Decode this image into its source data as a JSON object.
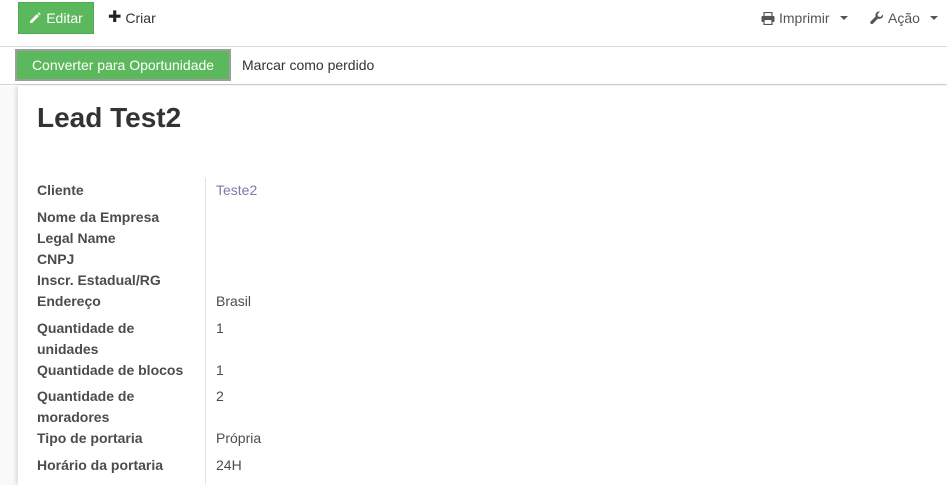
{
  "toolbar": {
    "edit_label": "Editar",
    "create_label": "Criar",
    "print_label": "Imprimir",
    "action_label": "Ação"
  },
  "statusbar": {
    "convert_label": "Converter para Oportunidade",
    "lost_label": "Marcar como perdido"
  },
  "record": {
    "title": "Lead Test2",
    "fields": [
      {
        "label": "Cliente",
        "value": "Teste2"
      },
      {
        "label": "Nome da Empresa",
        "value": ""
      },
      {
        "label": "Legal Name",
        "value": ""
      },
      {
        "label": "CNPJ",
        "value": ""
      },
      {
        "label": "Inscr. Estadual/RG",
        "value": ""
      },
      {
        "label": "Endereço",
        "value": "Brasil"
      },
      {
        "label": "Quantidade de unidades",
        "value": "1"
      },
      {
        "label": "Quantidade de blocos",
        "value": "1"
      },
      {
        "label": "Quantidade de moradores",
        "value": "2"
      },
      {
        "label": "Tipo de portaria",
        "value": "Própria"
      },
      {
        "label": "Horário da portaria",
        "value": "24H"
      }
    ]
  },
  "colors": {
    "primary": "#5cb85c",
    "link": "#7c7bad"
  },
  "icons": {
    "edit": "pencil-icon",
    "create": "plus-icon",
    "print": "printer-icon",
    "action": "wrench-icon"
  }
}
